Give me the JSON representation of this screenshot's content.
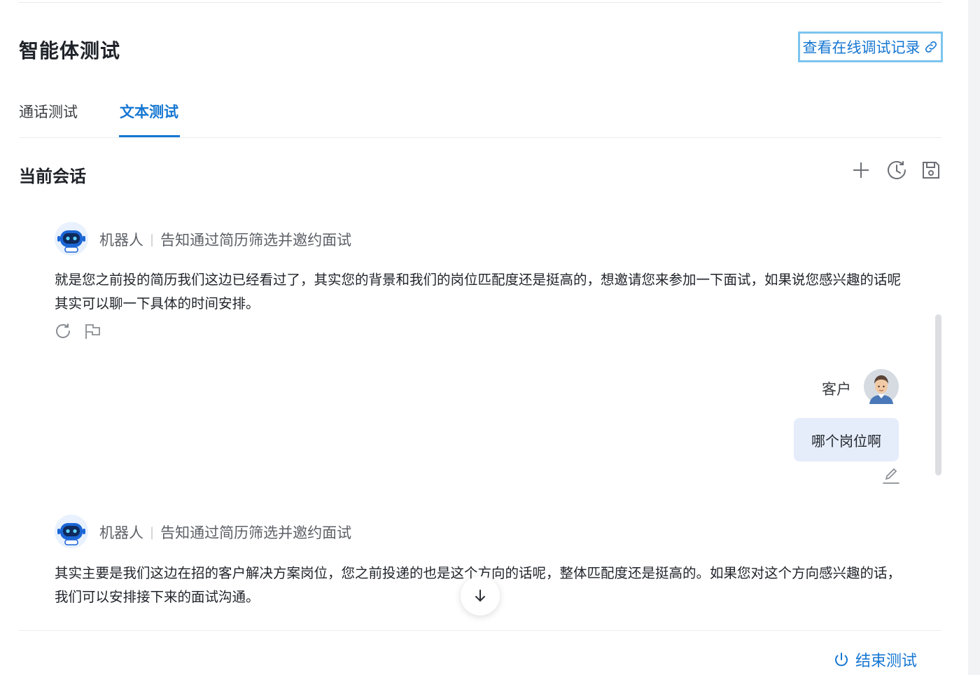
{
  "header": {
    "title": "智能体测试",
    "log_button_label": "查看在线调试记录"
  },
  "tabs": [
    {
      "label": "通话测试",
      "active": false
    },
    {
      "label": "文本测试",
      "active": true
    }
  ],
  "session": {
    "title": "当前会话",
    "tools": [
      "plus-icon",
      "history-icon",
      "save-icon"
    ]
  },
  "messages": [
    {
      "role": "bot",
      "sender": "机器人",
      "node": "告知通过简历筛选并邀约面试",
      "text": "就是您之前投的简历我们这边已经看过了，其实您的背景和我们的岗位匹配度还是挺高的，想邀请您来参加一下面试，如果说您感兴趣的话呢其实可以聊一下具体的时间安排。"
    },
    {
      "role": "customer",
      "sender": "客户",
      "text": "哪个岗位啊"
    },
    {
      "role": "bot",
      "sender": "机器人",
      "node": "告知通过简历筛选并邀约面试",
      "text": "其实主要是我们这边在招的客户解决方案岗位，您之前投递的也是这个方向的话呢，整体匹配度还是挺高的。如果您对这个方向感兴趣的话，我们可以安排接下来的面试沟通。"
    }
  ],
  "footer": {
    "end_button_label": "结束测试"
  },
  "colors": {
    "accent": "#1677d2",
    "user_bubble": "#e5edfb",
    "focus_border": "#7cc4ee"
  }
}
